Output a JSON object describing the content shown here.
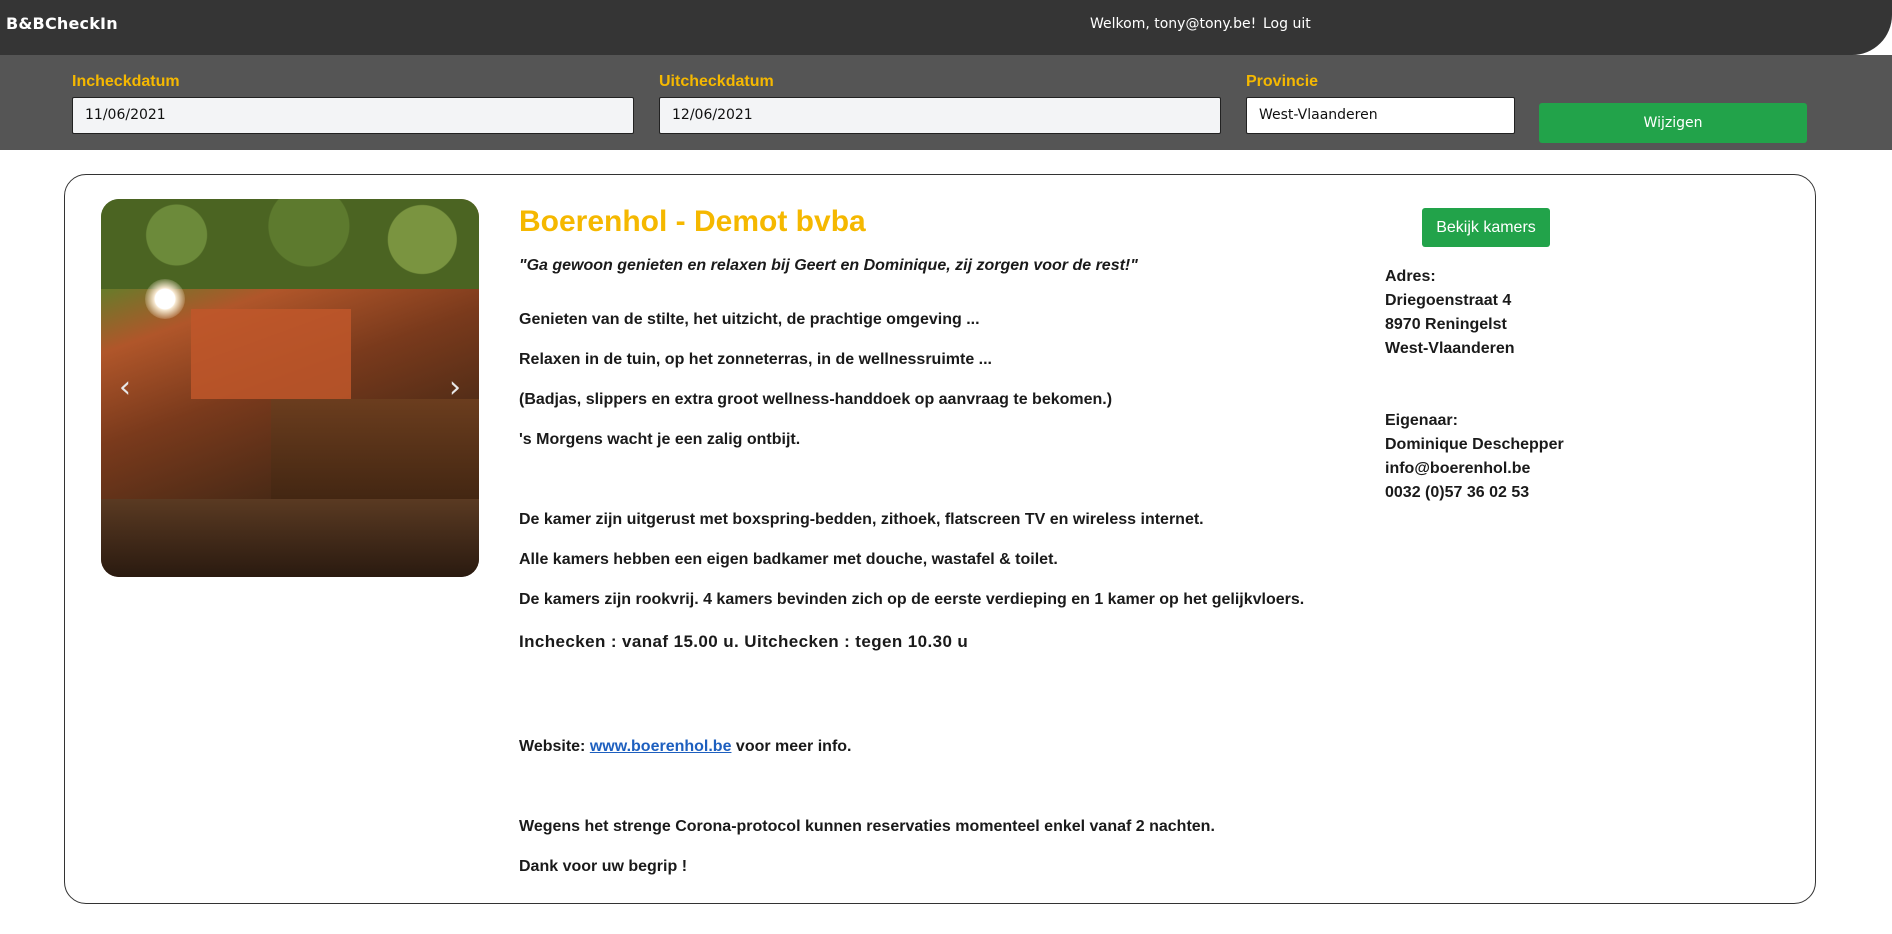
{
  "navbar": {
    "brand": "B&BCheckIn",
    "welcome": "Welkom, tony@tony.be!",
    "logout": "Log uit"
  },
  "filters": {
    "checkin_label": "Incheckdatum",
    "checkin_value": "11/06/2021",
    "checkout_label": "Uitcheckdatum",
    "checkout_value": "12/06/2021",
    "province_label": "Provincie",
    "province_value": "West-Vlaanderen",
    "submit_label": "Wijzigen"
  },
  "listing": {
    "title": "Boerenhol - Demot bvba",
    "quote": "\"Ga gewoon genieten en relaxen bij Geert en Dominique, zij zorgen voor de rest!\"",
    "paragraphs": [
      "Genieten van de stilte, het uitzicht, de prachtige omgeving ...",
      "Relaxen in de tuin, op het zonneterras, in de wellnessruimte ...",
      "(Badjas, slippers en extra groot wellness-handdoek op aanvraag te bekomen.)",
      "'s Morgens wacht je een zalig ontbijt.",
      "De kamer zijn uitgerust met boxspring-bedden, zithoek, flatscreen TV en wireless internet.",
      "Alle kamers hebben een eigen badkamer met douche, wastafel & toilet.",
      "De kamers zijn rookvrij. 4 kamers bevinden zich op de eerste verdieping en 1 kamer op het gelijkvloers.",
      "Inchecken : vanaf 15.00 u. Uitchecken : tegen 10.30 u"
    ],
    "website_prefix": "Website: ",
    "website_link": "www.boerenhol.be",
    "website_suffix": " voor meer info.",
    "corona_notice": "Wegens het strenge Corona-protocol kunnen reservaties momenteel enkel vanaf 2 nachten.",
    "thanks": "Dank voor uw begrip !",
    "view_rooms_label": "Bekijk kamers",
    "address": {
      "heading": "Adres:",
      "street": "Driegoenstraat 4",
      "city": "8970 Reningelst",
      "province": "West-Vlaanderen"
    },
    "owner": {
      "heading": "Eigenaar:",
      "name": "Dominique Deschepper",
      "email": "info@boerenhol.be",
      "phone": "0032 (0)57 36 02 53"
    },
    "carousel": {
      "prev_icon": "‹",
      "next_icon": "›"
    }
  }
}
